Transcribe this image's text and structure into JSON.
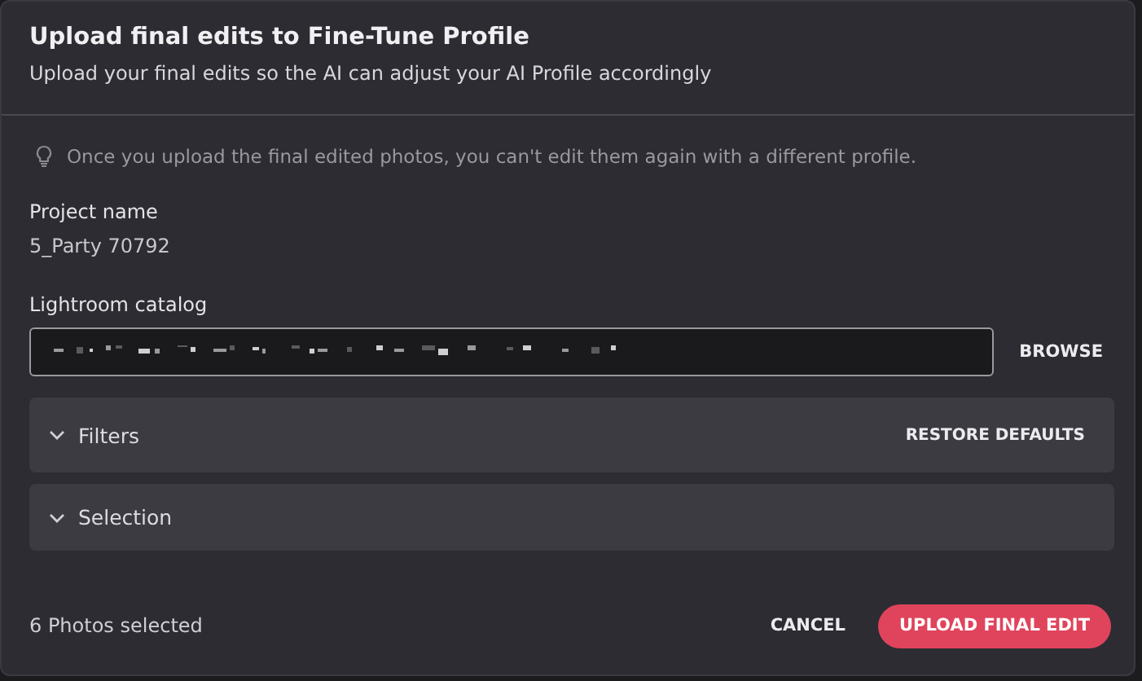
{
  "dialog": {
    "title": "Upload final edits to Fine-Tune Profile",
    "subtitle": "Upload your final edits so the AI can adjust your AI Profile accordingly"
  },
  "notice": "Once you upload the final edited photos, you can't edit them again with a different profile.",
  "project": {
    "label": "Project name",
    "value": "5_Party 70792"
  },
  "catalog": {
    "label": "Lightroom catalog",
    "browse": "BROWSE"
  },
  "sections": [
    {
      "title": "Filters",
      "expanded": false,
      "action": "RESTORE DEFAULTS"
    },
    {
      "title": "Selection",
      "expanded": false
    }
  ],
  "footer": {
    "status": "6 Photos selected",
    "cancel": "CANCEL",
    "submit": "UPLOAD FINAL EDIT"
  }
}
